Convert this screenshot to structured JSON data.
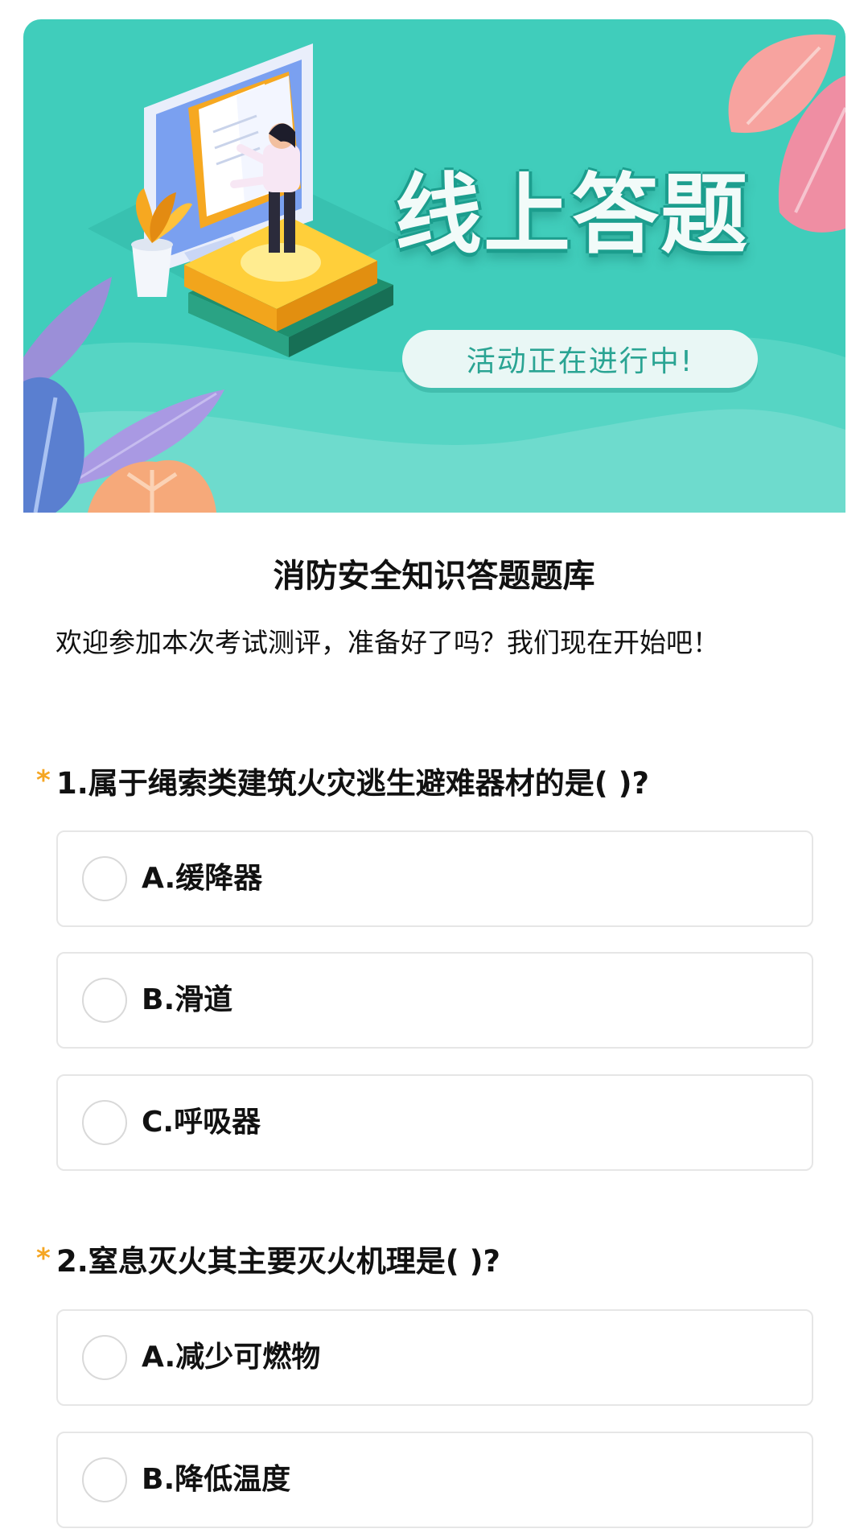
{
  "banner": {
    "title": "线上答题",
    "status_pill": "活动正在进行中!"
  },
  "quiz": {
    "title": "消防安全知识答题题库",
    "intro": "欢迎参加本次考试测评，准备好了吗？我们现在开始吧！"
  },
  "questions": [
    {
      "required_mark": "*",
      "title": "1.属于绳索类建筑火灾逃生避难器材的是(   )?",
      "options": [
        "A.缓降器",
        "B.滑道",
        "C.呼吸器"
      ]
    },
    {
      "required_mark": "*",
      "title": "2.窒息灭火其主要灭火机理是(   )?",
      "options": [
        "A.减少可燃物",
        "B.降低温度"
      ]
    }
  ],
  "colors": {
    "banner_bg": "#40cdbb",
    "required_mark": "#f5a623",
    "option_border": "#e6e6e6"
  }
}
